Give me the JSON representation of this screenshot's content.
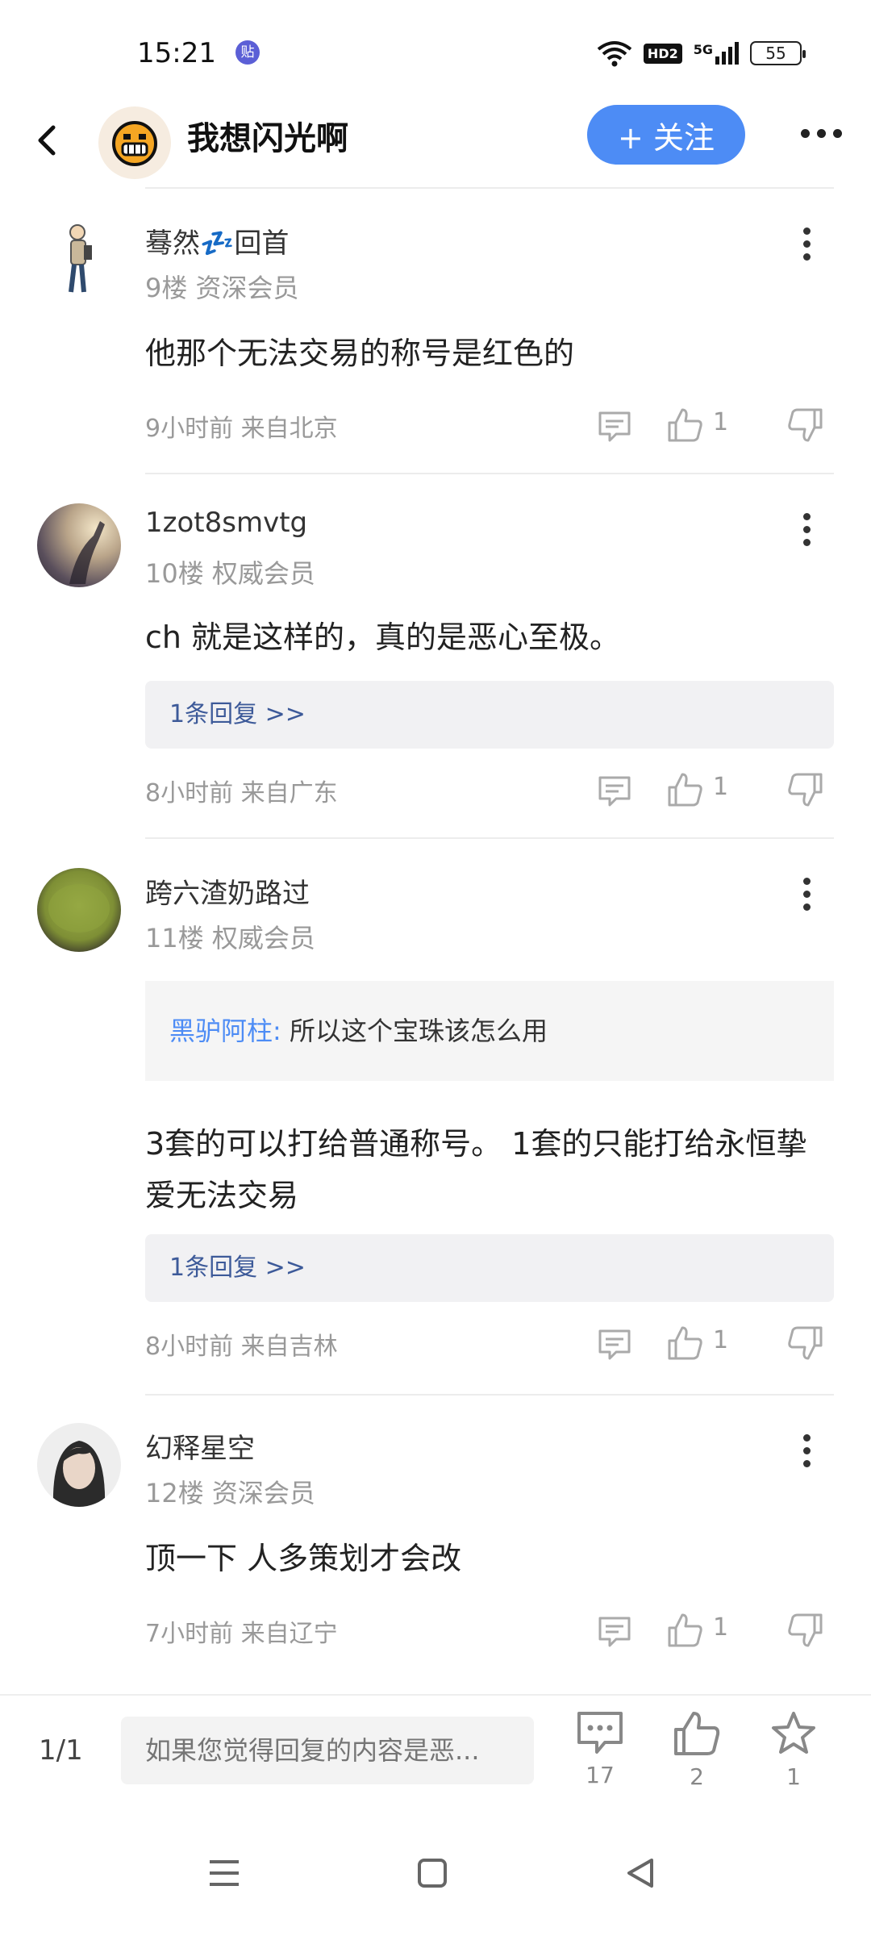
{
  "status_bar": {
    "time": "15:21",
    "app_icon_glyph": "贴",
    "hd_label": "HD2",
    "network_label": "5G",
    "battery": "55"
  },
  "header": {
    "back_icon": "back-arrow-icon",
    "title": "我想闪光啊",
    "follow_label": "+ 关注",
    "more_icon": "more-dots-icon",
    "accent_color": "#4d8cf5"
  },
  "posts": [
    {
      "username": "蓦然",
      "username_emoji": "💤",
      "username_suffix": "回首",
      "floor": "9楼 资深会员",
      "content": "他那个无法交易的称号是红色的",
      "time_location": "9小时前 来自北京",
      "likes": "1"
    },
    {
      "username": "1zot8smvtg",
      "floor": "10楼 权威会员",
      "content": "ch 就是这样的，真的是恶心至极。",
      "reply_link": "1条回复 >>",
      "time_location": "8小时前 来自广东",
      "likes": "1"
    },
    {
      "username": "跨六渣奶路过",
      "floor": "11楼 权威会员",
      "quote_name": "黑驴阿柱:",
      "quote_text": " 所以这个宝珠该怎么用",
      "content": "3套的可以打给普通称号。 1套的只能打给永恒挚爱无法交易",
      "reply_link": "1条回复 >>",
      "time_location": "8小时前 来自吉林",
      "likes": "1"
    },
    {
      "username": "幻释星空",
      "floor": "12楼 资深会员",
      "content": "顶一下 人多策划才会改",
      "time_location": "7小时前 来自辽宁",
      "likes": "1"
    }
  ],
  "bottom_bar": {
    "page_indicator": "1/1",
    "reply_placeholder": "如果您觉得回复的内容是恶...",
    "comment_count": "17",
    "like_count": "2",
    "favorite_count": "1"
  }
}
